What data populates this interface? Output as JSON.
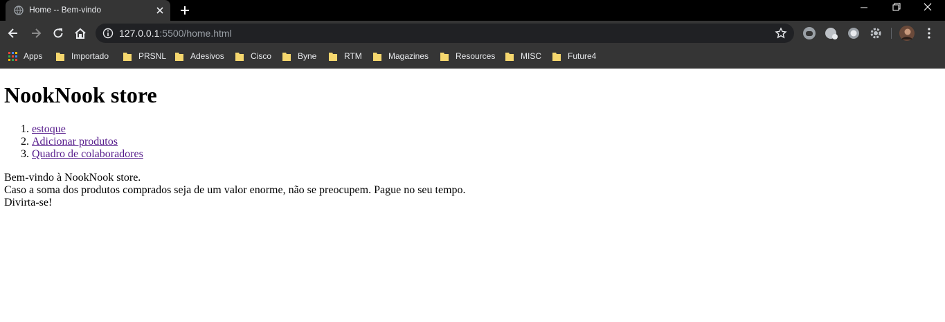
{
  "browser": {
    "tab": {
      "title": "Home -- Bem-vindo"
    },
    "address": {
      "host": "127.0.0.1",
      "rest": ":5500/home.html"
    },
    "bookmarks": [
      "Apps",
      "Importado",
      "PRSNL",
      "Adesivos",
      "Cisco",
      "Byne",
      "RTM",
      "Magazines",
      "Resources",
      "MISC",
      "Future4"
    ]
  },
  "page": {
    "heading": "NookNook store",
    "nav_links": [
      "estoque",
      "Adicionar produtos",
      "Quadro de colaboradores"
    ],
    "welcome_lines": [
      "Bem-vindo à NookNook store.",
      "Caso a soma dos produtos comprados seja de um valor enorme, não se preocupem. Pague no seu tempo.",
      "Divirta-se!"
    ]
  },
  "colors": {
    "chrome_dark": "#000000",
    "toolbar": "#353535",
    "omnibox": "#202124",
    "visited_link": "#551a8b",
    "folder": "#f5d76e"
  }
}
